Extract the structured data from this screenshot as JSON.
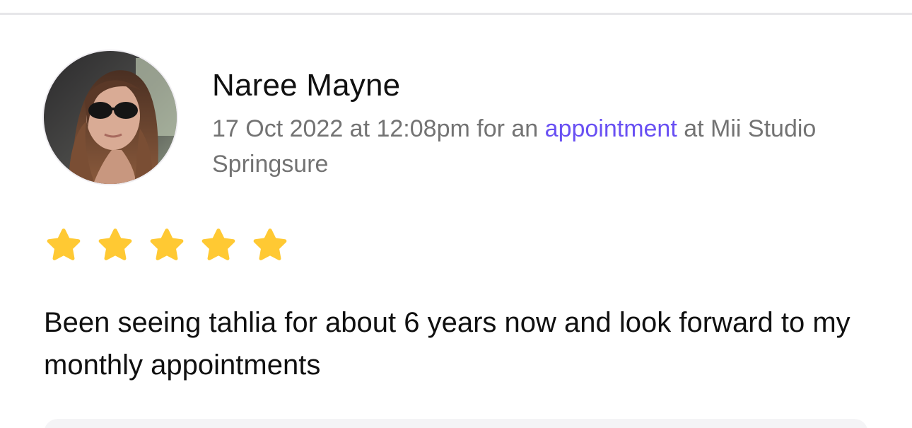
{
  "review": {
    "reviewer_name": "Naree Mayne",
    "date_text": "17 Oct 2022 at 12:08pm for an",
    "link_text": "appointment",
    "location_text": "at Mii Studio Springsure",
    "rating": 5,
    "max_rating": 5,
    "body": "Been seeing tahlia for about 6 years now and look forward to my monthly appointments"
  },
  "colors": {
    "link": "#6950f3",
    "star": "#ffc933",
    "meta_text": "#737373"
  },
  "icons": {
    "rating": "star-icon"
  }
}
